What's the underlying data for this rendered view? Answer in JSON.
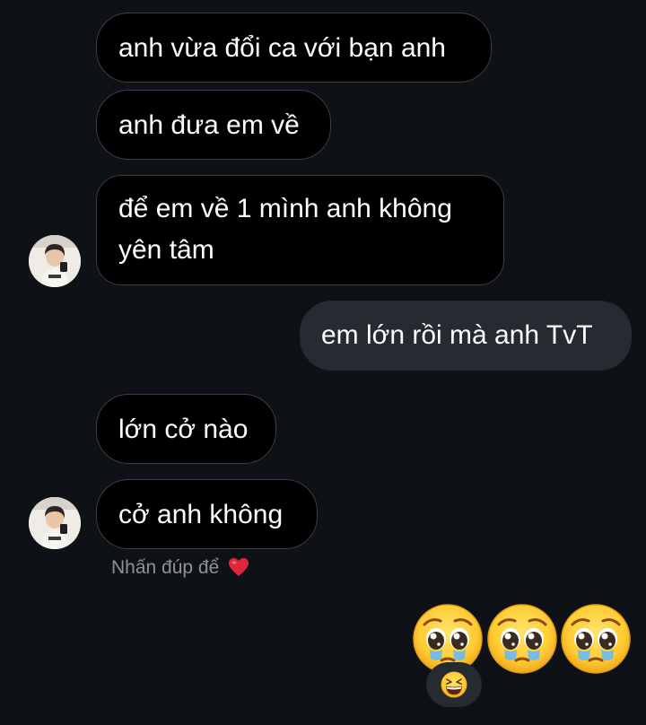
{
  "messages": [
    {
      "direction": "incoming",
      "text": "anh vừa đổi ca với bạn anh"
    },
    {
      "direction": "incoming",
      "text": "anh đưa em về"
    },
    {
      "direction": "incoming",
      "text": "để em về 1 mình anh không yên tâm"
    },
    {
      "direction": "outgoing",
      "text": "em lớn rồi mà anh TvT"
    },
    {
      "direction": "incoming",
      "text": "lớn cở nào"
    },
    {
      "direction": "incoming",
      "text": "cở anh không"
    }
  ],
  "double_tap_hint": {
    "text": "Nhấn đúp để",
    "icon": "red-heart"
  },
  "emoji_message": {
    "emojis": [
      "pleading-face",
      "pleading-face",
      "pleading-face"
    ]
  },
  "reaction": {
    "emoji": "grinning-squinting-face"
  },
  "colors": {
    "background": "#0e1116",
    "incoming_bubble": "#000000",
    "incoming_border": "#3a3d44",
    "outgoing_bubble": "#262a31",
    "text": "#ffffff",
    "hint_text": "#8e9299",
    "heart": "#e0243a"
  }
}
